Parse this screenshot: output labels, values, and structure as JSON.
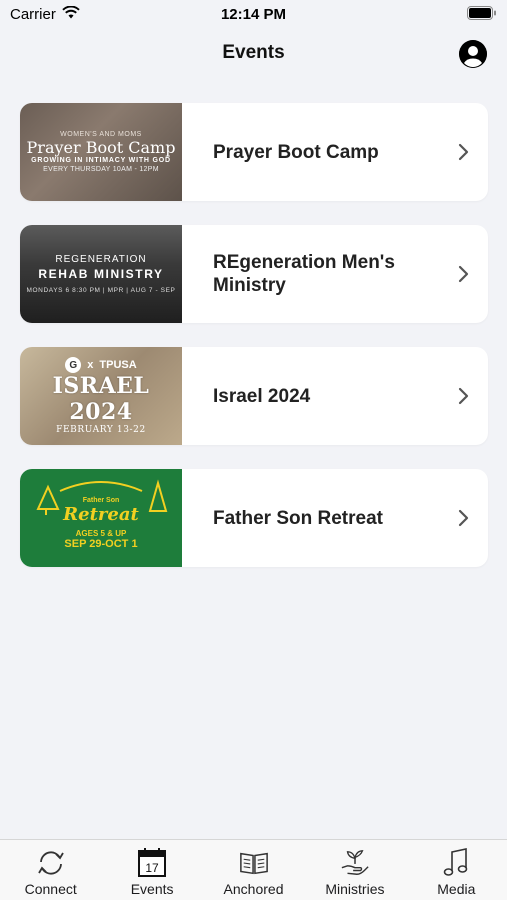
{
  "status_bar": {
    "carrier": "Carrier",
    "time": "12:14 PM"
  },
  "header": {
    "title": "Events"
  },
  "events": [
    {
      "title": "Prayer Boot Camp",
      "thumb": {
        "line1": "WOMEN'S AND MOMS",
        "line2": "Prayer Boot Camp",
        "line3": "GROWING IN INTIMACY WITH GOD",
        "line4": "EVERY THURSDAY 10AM - 12PM"
      }
    },
    {
      "title": "REgeneration Men's Ministry",
      "thumb": {
        "line1": "REGENERATION",
        "line2": "REHAB MINISTRY",
        "line3": "MONDAYS 6 8:30 PM | MPR | AUG 7 - SEP"
      }
    },
    {
      "title": "Israel 2024",
      "thumb": {
        "logo_left": "G",
        "logo_sep": "x",
        "logo_right": "TPUSA",
        "line1": "ISRAEL 2024",
        "line2": "FEBRUARY 13-22"
      }
    },
    {
      "title": "Father Son Retreat",
      "thumb": {
        "line1": "Father Son",
        "line2": "Retreat",
        "line3": "AGES 5 & UP",
        "line4": "SEP 29-OCT 1"
      }
    }
  ],
  "tabs": [
    {
      "label": "Connect",
      "icon": "connect-icon"
    },
    {
      "label": "Events",
      "icon": "calendar-icon",
      "badge": "17"
    },
    {
      "label": "Anchored",
      "icon": "book-icon"
    },
    {
      "label": "Ministries",
      "icon": "hand-plant-icon"
    },
    {
      "label": "Media",
      "icon": "music-note-icon"
    }
  ]
}
